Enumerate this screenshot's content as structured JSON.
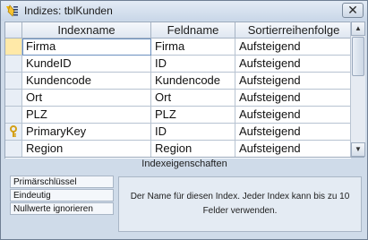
{
  "window": {
    "title": "Indizes: tblKunden",
    "close_glyph": "✕"
  },
  "grid": {
    "columns": [
      "Indexname",
      "Feldname",
      "Sortierreihenfolge"
    ],
    "rows": [
      {
        "indexname": "Firma",
        "feldname": "Firma",
        "sort": "Aufsteigend",
        "marker": ""
      },
      {
        "indexname": "KundeID",
        "feldname": "ID",
        "sort": "Aufsteigend",
        "marker": ""
      },
      {
        "indexname": "Kundencode",
        "feldname": "Kundencode",
        "sort": "Aufsteigend",
        "marker": ""
      },
      {
        "indexname": "Ort",
        "feldname": "Ort",
        "sort": "Aufsteigend",
        "marker": ""
      },
      {
        "indexname": "PLZ",
        "feldname": "PLZ",
        "sort": "Aufsteigend",
        "marker": ""
      },
      {
        "indexname": "PrimaryKey",
        "feldname": "ID",
        "sort": "Aufsteigend",
        "marker": "key-icon"
      },
      {
        "indexname": "Region",
        "feldname": "Region",
        "sort": "Aufsteigend",
        "marker": ""
      }
    ]
  },
  "properties": {
    "section_label": "Indexeigenschaften",
    "items": [
      "Primärschlüssel",
      "Eindeutig",
      "Nullwerte ignorieren"
    ],
    "description": "Der Name für diesen Index. Jeder Index kann bis zu 10 Felder verwenden."
  },
  "scrollbar": {
    "up_glyph": "▲",
    "down_glyph": "▼"
  },
  "colors": {
    "accent": "#6a8fbf",
    "key": "#d4a017"
  }
}
